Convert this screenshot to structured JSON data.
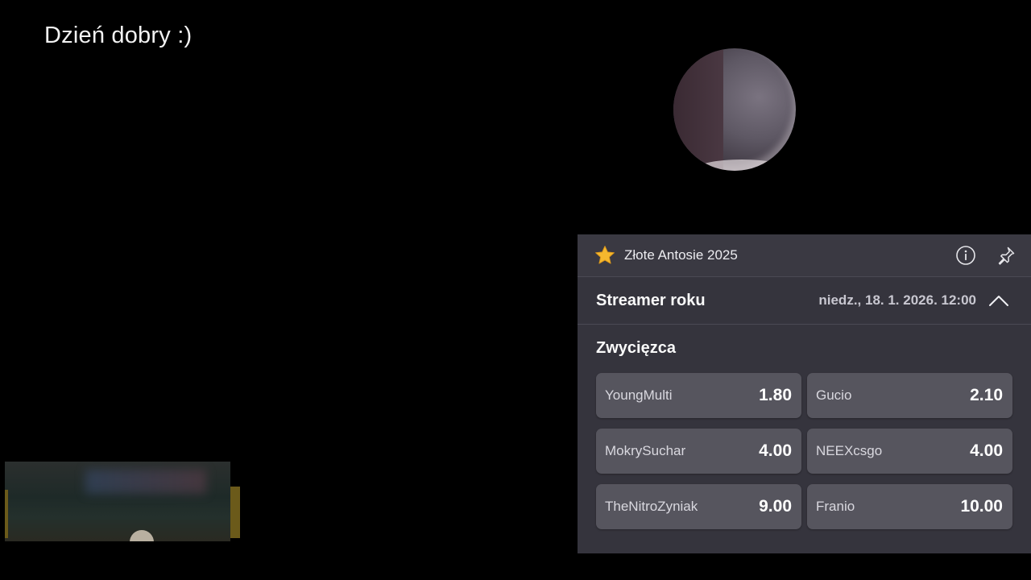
{
  "greeting": "Dzień dobry :)",
  "panel": {
    "title": "Złote Antosie 2025",
    "event": {
      "name": "Streamer roku",
      "datetime": "niedz., 18. 1. 2026. 12:00"
    },
    "market": {
      "title": "Zwycięzca",
      "selections": [
        {
          "name": "YoungMulti",
          "odds": "1.80"
        },
        {
          "name": "Gucio",
          "odds": "2.10"
        },
        {
          "name": "MokrySuchar",
          "odds": "4.00"
        },
        {
          "name": "NEEXcsgo",
          "odds": "4.00"
        },
        {
          "name": "TheNitroZyniak",
          "odds": "9.00"
        },
        {
          "name": "Franio",
          "odds": "10.00"
        }
      ]
    }
  },
  "icons": {
    "title": "star-icon",
    "info": "info-icon",
    "pin": "pin-icon",
    "collapse": "chevron-up-icon"
  },
  "colors": {
    "background": "#000000",
    "panel": "#35343d",
    "odds_button": "#56555e",
    "star": "#f5b82e"
  }
}
